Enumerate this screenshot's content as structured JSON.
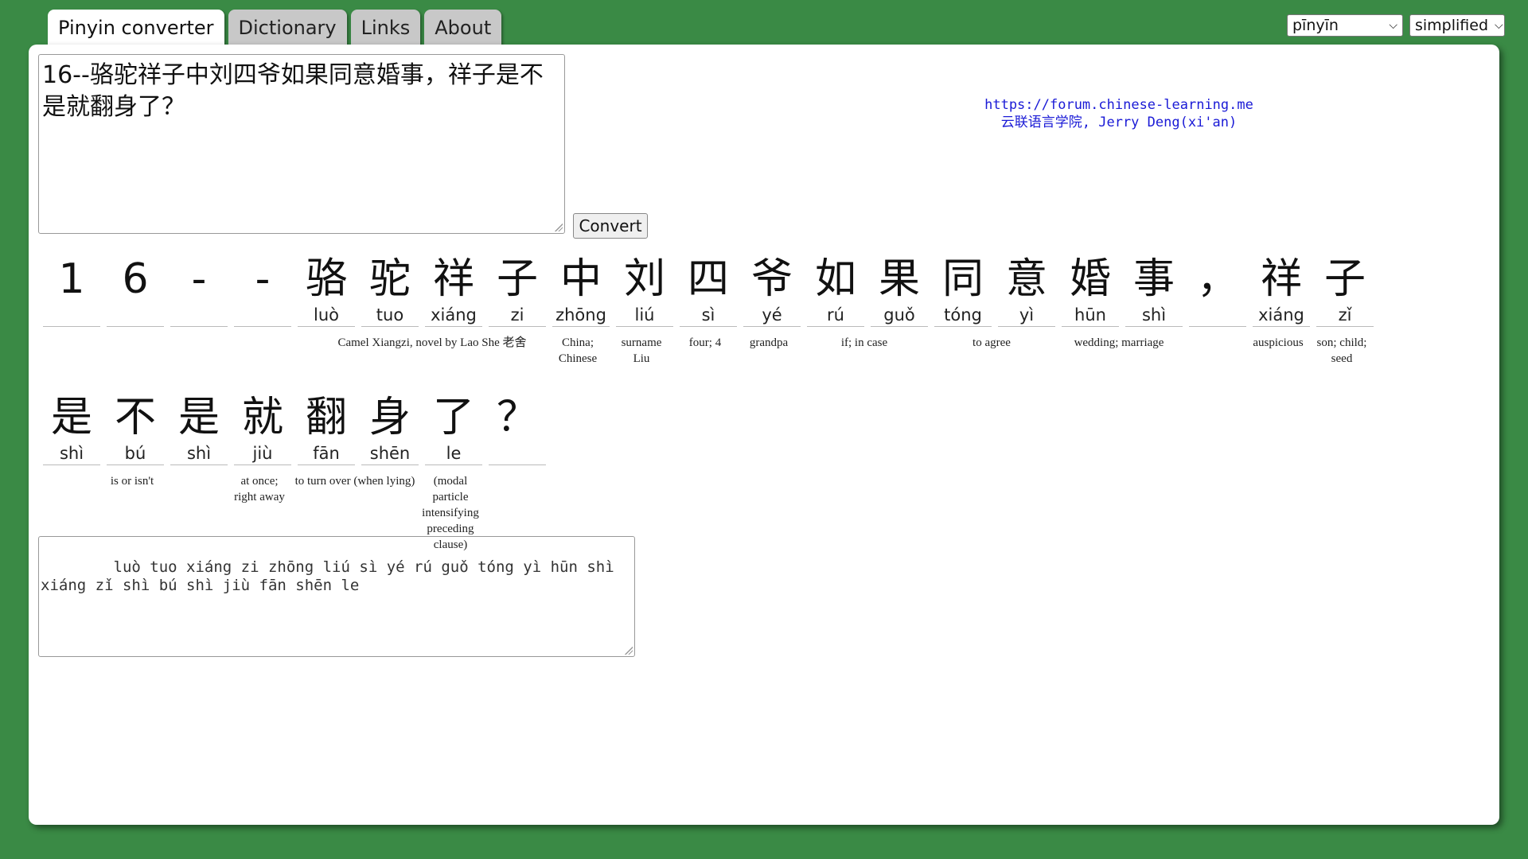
{
  "tabs": [
    "Pinyin converter",
    "Dictionary",
    "Links",
    "About"
  ],
  "controls": {
    "tone_select": "pīnyīn",
    "script_select": "simplified",
    "convert_label": "Convert"
  },
  "input_text": "16--骆驼祥子中刘四爷如果同意婚事，祥子是不是就翻身了？",
  "credit": {
    "url": "https://forum.chinese-learning.me",
    "line2": "云联语言学院, Jerry Deng(xi'an)"
  },
  "row1": [
    {
      "char": "1",
      "py": ""
    },
    {
      "char": "6",
      "py": ""
    },
    {
      "char": "-",
      "py": ""
    },
    {
      "char": "-",
      "py": ""
    },
    {
      "char": "骆",
      "py": "luò"
    },
    {
      "char": "驼",
      "py": "tuo"
    },
    {
      "char": "祥",
      "py": "xiáng"
    },
    {
      "char": "子",
      "py": "zi"
    },
    {
      "char": "中",
      "py": "zhōng"
    },
    {
      "char": "刘",
      "py": "liú"
    },
    {
      "char": "四",
      "py": "sì"
    },
    {
      "char": "爷",
      "py": "yé"
    },
    {
      "char": "如",
      "py": "rú"
    },
    {
      "char": "果",
      "py": "guǒ"
    },
    {
      "char": "同",
      "py": "tóng"
    },
    {
      "char": "意",
      "py": "yì"
    },
    {
      "char": "婚",
      "py": "hūn"
    },
    {
      "char": "事",
      "py": "shì"
    },
    {
      "char": "，",
      "py": ""
    },
    {
      "char": "祥",
      "py": "xiáng"
    },
    {
      "char": "子",
      "py": "zǐ"
    }
  ],
  "row1_defs": [
    "Camel Xiangzi, novel by Lao She 老舍",
    "China; Chinese",
    "surname Liu",
    "four; 4",
    "grandpa",
    "if; in case",
    "to agree",
    "wedding; marriage",
    "auspicious",
    "son; child; seed"
  ],
  "row2": [
    {
      "char": "是",
      "py": "shì"
    },
    {
      "char": "不",
      "py": "bú"
    },
    {
      "char": "是",
      "py": "shì"
    },
    {
      "char": "就",
      "py": "jiù"
    },
    {
      "char": "翻",
      "py": "fān"
    },
    {
      "char": "身",
      "py": "shēn"
    },
    {
      "char": "了",
      "py": "le"
    },
    {
      "char": "？",
      "py": ""
    }
  ],
  "row2_defs": [
    "is or isn't",
    "at once; right away",
    "to turn over (when lying)",
    "(modal particle intensifying preceding clause)"
  ],
  "output_text": "    luò tuo xiáng zi zhōng liú sì yé rú guǒ tóng yì hūn shì xiáng zǐ shì bú shì jiù fān shēn le"
}
